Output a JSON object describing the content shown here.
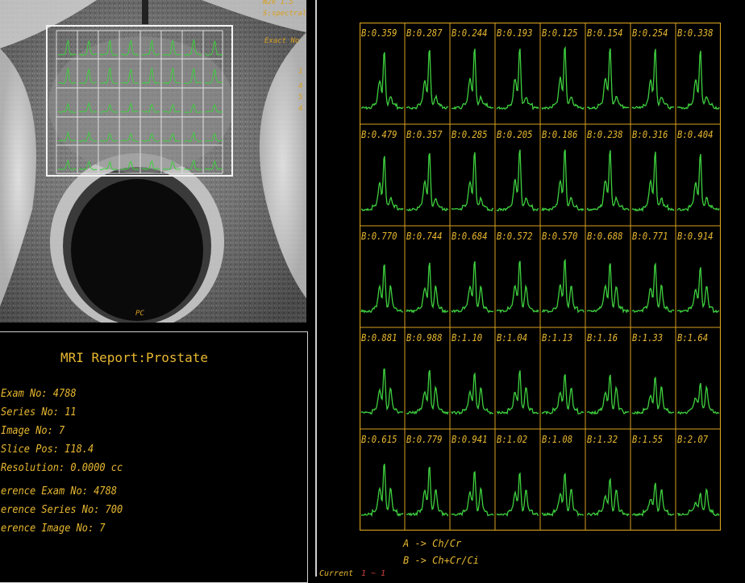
{
  "mri": {
    "wl": "W2k 1.5",
    "sub": "S:spectral",
    "tag": "Exact No",
    "marks": [
      "1",
      "4",
      "5",
      "4"
    ],
    "bottom_marker": "PC"
  },
  "report": {
    "title": "MRI Report:Prostate",
    "lines": [
      "Exam No: 4788",
      "Series No: 11",
      "Image No: 7",
      "Slice Pos: I18.4",
      "Resolution: 0.0000 cc",
      "erence Exam No: 4788",
      "erence Series No: 700",
      "erence Image No: 7"
    ]
  },
  "grid": {
    "rows": [
      [
        "B:0.359",
        "B:0.287",
        "B:0.244",
        "B:0.193",
        "B:0.125",
        "B:0.154",
        "B:0.254",
        "B:0.338"
      ],
      [
        "B:0.479",
        "B:0.357",
        "B:0.285",
        "B:0.205",
        "B:0.186",
        "B:0.238",
        "B:0.316",
        "B:0.404"
      ],
      [
        "B:0.770",
        "B:0.744",
        "B:0.684",
        "B:0.572",
        "B:0.570",
        "B:0.688",
        "B:0.771",
        "B:0.914"
      ],
      [
        "B:0.881",
        "B:0.988",
        "B:1.10",
        "B:1.04",
        "B:1.13",
        "B:1.16",
        "B:1.33",
        "B:1.64"
      ],
      [
        "B:0.615",
        "B:0.779",
        "B:0.941",
        "B:1.02",
        "B:1.08",
        "B:1.32",
        "B:1.55",
        "B:2.07"
      ]
    ]
  },
  "legend": {
    "a": "A -> Ch/Cr",
    "b": "B -> Ch+Cr/Ci"
  },
  "footer": {
    "current": "Current",
    "current_value": "1 ~ 1"
  },
  "colors": {
    "grid": "#d8a020",
    "spectrum": "#3ecf3e",
    "text": "#e8b830"
  }
}
